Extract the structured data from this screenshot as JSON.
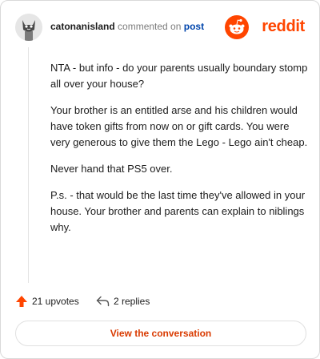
{
  "header": {
    "username": "catonanisland",
    "action_text": "commented on",
    "post_link": "post",
    "brand_name": "reddit"
  },
  "comment": {
    "paragraphs": [
      "NTA - but info - do your parents usually boundary stomp all over your house?",
      "Your brother is an entitled arse and his children would have token gifts from now on or gift cards. You were very generous to give them the Lego - Lego ain't cheap.",
      "Never hand that PS5 over.",
      "P.s. - that would be the last time they've allowed in your house. Your brother and parents can explain to niblings why."
    ]
  },
  "actions": {
    "upvotes_label": "21 upvotes",
    "replies_label": "2 replies"
  },
  "cta": {
    "label": "View the conversation"
  },
  "colors": {
    "brand": "#ff4500",
    "link": "#0045ac",
    "cta_text": "#d93a00"
  },
  "icons": [
    "avatar-cat-icon",
    "reddit-snoo-icon",
    "upvote-arrow-icon",
    "reply-arrow-icon"
  ]
}
